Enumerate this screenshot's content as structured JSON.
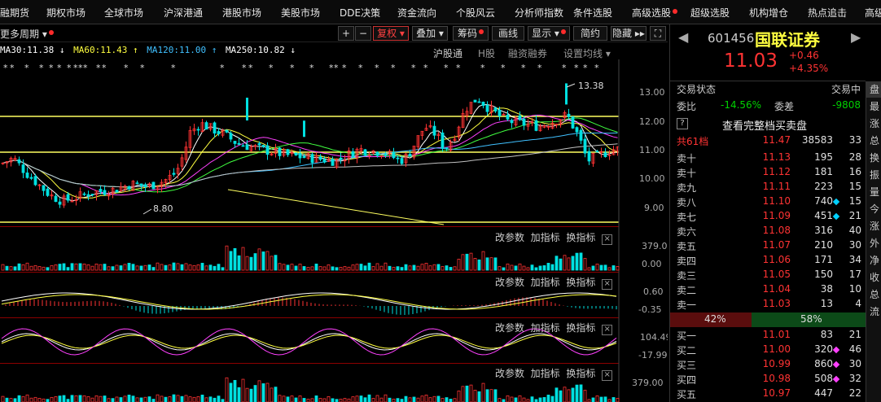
{
  "menu": [
    "融期货",
    "期权市场",
    "全球市场",
    "沪深港通",
    "港股市场",
    "美股市场",
    "DDE决策",
    "资金流向",
    "个股风云",
    "分析师指数",
    "条件选股",
    "高级选股",
    "超级选股",
    "机构增仓",
    "热点追击",
    "高级"
  ],
  "toolbar": {
    "period": "更多周期",
    "plus": "+",
    "minus": "−",
    "fuquan": "复权",
    "diejia": "叠加",
    "chouma": "筹码",
    "huaxian": "画线",
    "xianshi": "显示",
    "jianyue": "简约",
    "yincang": "隐藏",
    "fastfwd": "▸▸",
    "fullscreen": "⛶"
  },
  "ma": {
    "ma30": "MA30:11.38 ↓",
    "ma60": "MA60:11.43 ↑",
    "ma120": "MA120:11.00 ↑",
    "ma250": "MA250:10.82 ↓",
    "hugutong": "沪股通",
    "hgu": "H股",
    "rongzi": "融资融券",
    "shezhi": "设置均线"
  },
  "main_chart": {
    "y_ticks": [
      "13.00",
      "12.00",
      "11.00",
      "10.00",
      "9.00"
    ],
    "high_label": "13.38",
    "low_label": "8.80"
  },
  "panels": [
    {
      "gaicanshu": "改参数",
      "jiazhibiao": "加指标",
      "huanzhibiao": "换指标",
      "close": "×",
      "ticks": [
        "379.00",
        "0.00"
      ]
    },
    {
      "gaicanshu": "改参数",
      "jiazhibiao": "加指标",
      "huanzhibiao": "换指标",
      "close": "×",
      "ticks": [
        "0.60",
        "-0.35"
      ]
    },
    {
      "gaicanshu": "改参数",
      "jiazhibiao": "加指标",
      "huanzhibiao": "换指标",
      "close": "×",
      "ticks": [
        "104.49",
        "-17.99"
      ]
    },
    {
      "gaicanshu": "改参数",
      "jiazhibiao": "加指标",
      "huanzhibiao": "换指标",
      "close": "×",
      "ticks": [
        "379.00"
      ]
    }
  ],
  "stock": {
    "code": "601456",
    "name": "国联证券",
    "price": "11.03",
    "change": "+0.46",
    "change_pct": "+4.35%"
  },
  "orderbook": {
    "status_label": "交易状态",
    "status_value": "交易中",
    "weibi_label": "委比",
    "weibi_value": "-14.56%",
    "weicha_label": "委差",
    "weicha_value": "-9808",
    "full_book": "查看完整档买卖盘",
    "summary": {
      "label": "共61档",
      "price": "11.47",
      "vol": "38583",
      "cnt": "33"
    },
    "asks": [
      {
        "label": "卖十",
        "price": "11.13",
        "vol": "195",
        "cnt": "28",
        "mark": ""
      },
      {
        "label": "卖十",
        "price": "11.12",
        "vol": "181",
        "cnt": "16",
        "mark": ""
      },
      {
        "label": "卖九",
        "price": "11.11",
        "vol": "223",
        "cnt": "15",
        "mark": ""
      },
      {
        "label": "卖八",
        "price": "11.10",
        "vol": "740",
        "cnt": "15",
        "mark": "#00d0ff"
      },
      {
        "label": "卖七",
        "price": "11.09",
        "vol": "451",
        "cnt": "21",
        "mark": "#00d0ff"
      },
      {
        "label": "卖六",
        "price": "11.08",
        "vol": "316",
        "cnt": "40",
        "mark": ""
      },
      {
        "label": "卖五",
        "price": "11.07",
        "vol": "210",
        "cnt": "30",
        "mark": ""
      },
      {
        "label": "卖四",
        "price": "11.06",
        "vol": "171",
        "cnt": "34",
        "mark": ""
      },
      {
        "label": "卖三",
        "price": "11.05",
        "vol": "150",
        "cnt": "17",
        "mark": ""
      },
      {
        "label": "卖二",
        "price": "11.04",
        "vol": "38",
        "cnt": "10",
        "mark": ""
      },
      {
        "label": "卖一",
        "price": "11.03",
        "vol": "13",
        "cnt": "4",
        "mark": ""
      }
    ],
    "ratio_sell": "42%",
    "ratio_buy": "58%",
    "bids": [
      {
        "label": "买一",
        "price": "11.01",
        "vol": "83",
        "cnt": "21",
        "mark": ""
      },
      {
        "label": "买二",
        "price": "11.00",
        "vol": "320",
        "cnt": "46",
        "mark": "#ff40ff"
      },
      {
        "label": "买三",
        "price": "10.99",
        "vol": "860",
        "cnt": "30",
        "mark": "#ff40ff"
      },
      {
        "label": "买四",
        "price": "10.98",
        "vol": "508",
        "cnt": "32",
        "mark": "#ff40ff"
      },
      {
        "label": "买五",
        "price": "10.97",
        "vol": "447",
        "cnt": "22",
        "mark": ""
      }
    ]
  },
  "side_tabs": [
    "盘",
    "最",
    "涨",
    "总",
    "换",
    "振",
    "量",
    "今",
    "涨",
    "外",
    "净",
    "收",
    "总",
    "流"
  ]
}
